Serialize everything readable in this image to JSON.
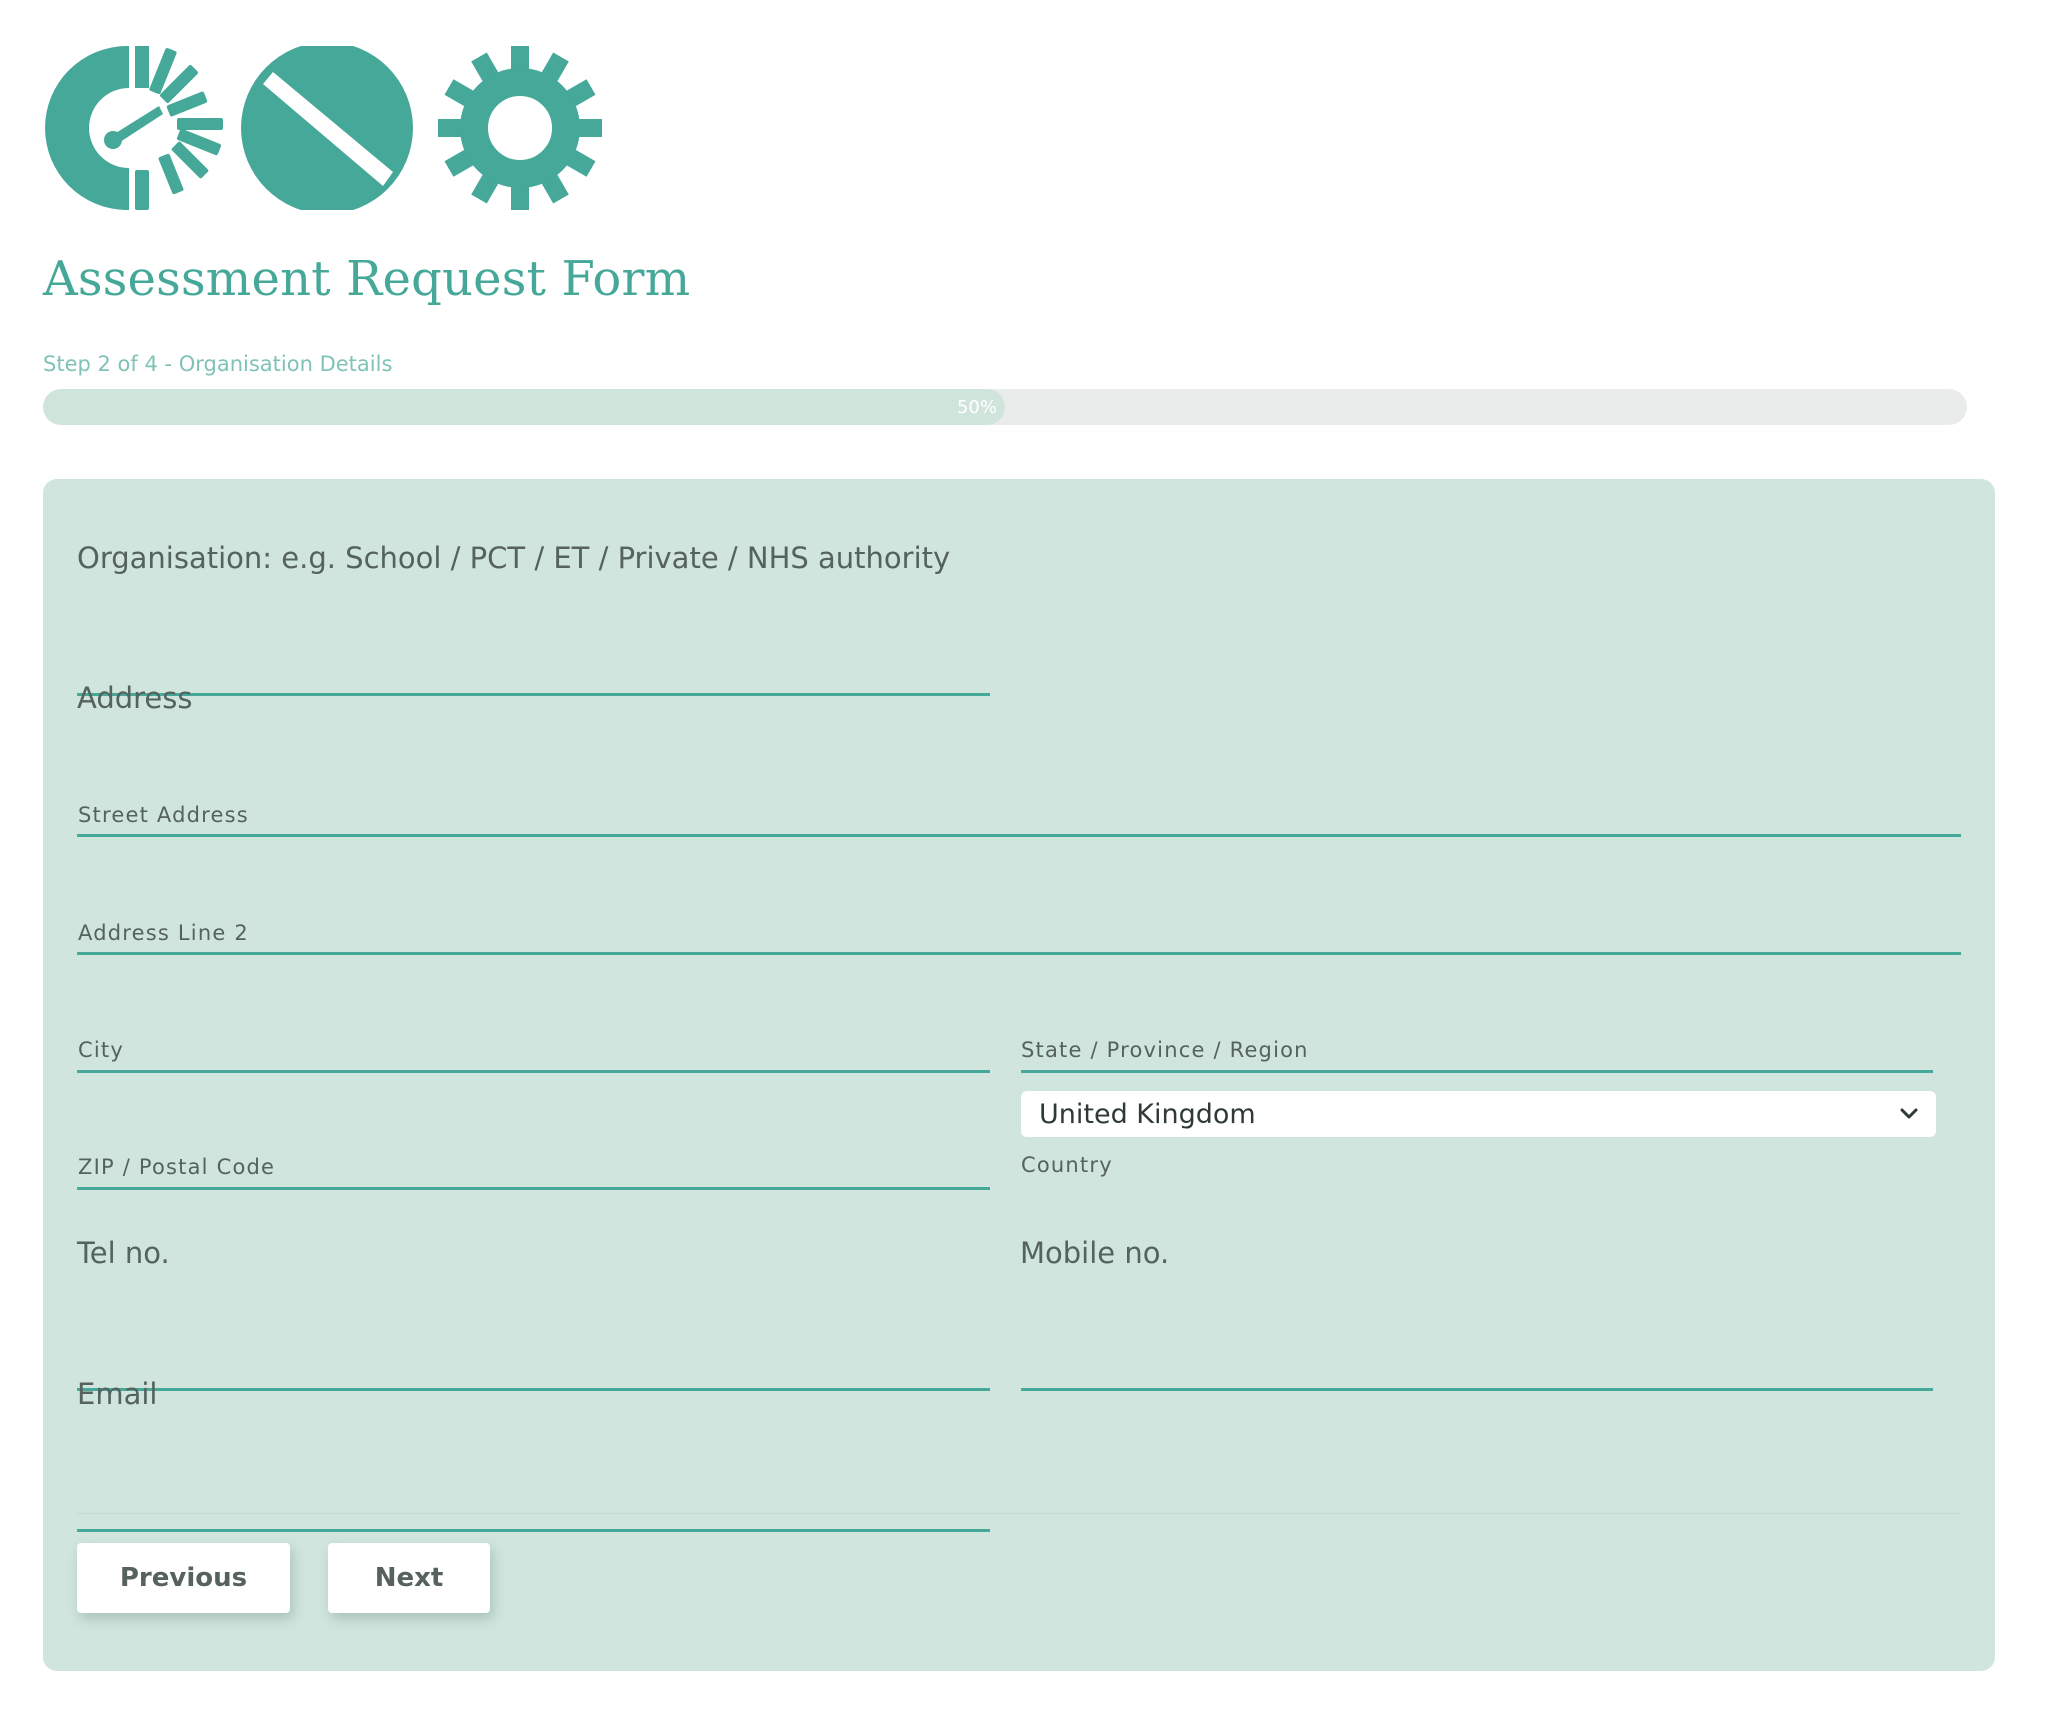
{
  "form": {
    "title": "Assessment Request Form",
    "step_text": "Step 2 of 4 - Organisation Details",
    "progress_percent": 50,
    "progress_label": "50%"
  },
  "fields": {
    "organisation_label": "Organisation: e.g. School / PCT / ET / Private / NHS authority",
    "address_label": "Address",
    "street_address_label": "Street Address",
    "address_line2_label": "Address Line 2",
    "city_label": "City",
    "state_label": "State / Province / Region",
    "zip_label": "ZIP / Postal Code",
    "country_label": "Country",
    "country_value": "United Kingdom",
    "tel_label": "Tel no.",
    "mobile_label": "Mobile no.",
    "email_label": "Email"
  },
  "buttons": {
    "previous": "Previous",
    "next": "Next"
  },
  "icons": {
    "logo": [
      "sun-gauge-icon",
      "no-sign-icon",
      "gear-icon"
    ],
    "select_arrow": "chevron-down-icon"
  },
  "colors": {
    "accent": "#45a898",
    "panel": "#d0e5dd",
    "progress_fill": "#cfe5dc",
    "progress_track": "#e9ecea",
    "text": "#56625e"
  }
}
